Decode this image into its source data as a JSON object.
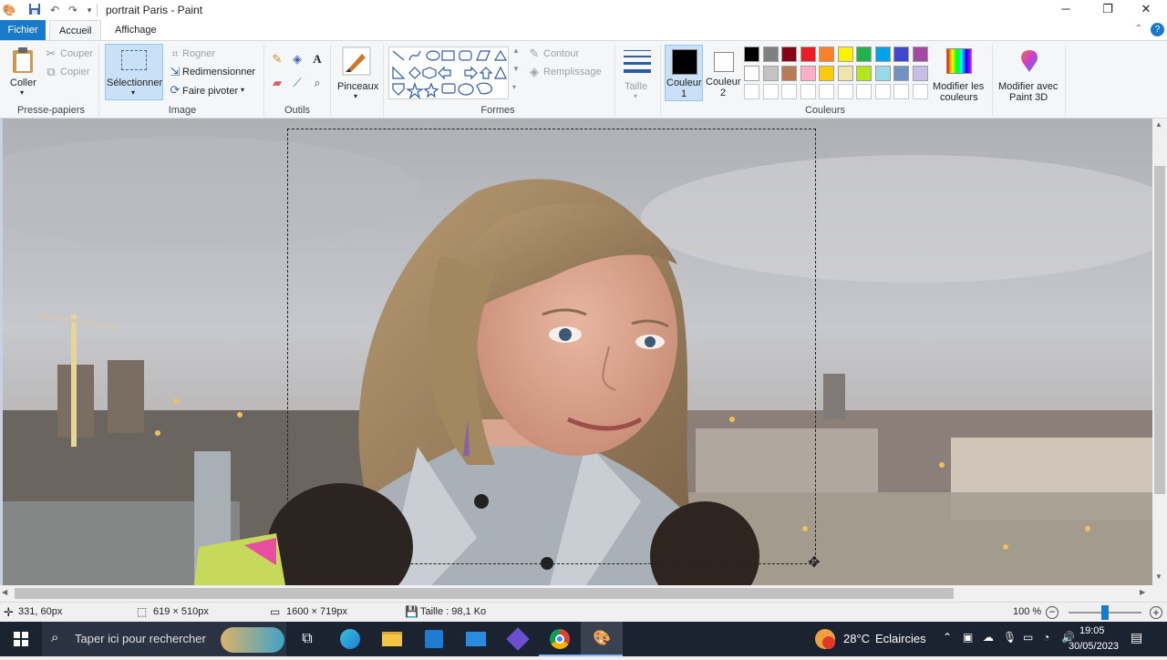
{
  "window": {
    "title": "portrait Paris - Paint",
    "quick_access": [
      "save-icon",
      "undo-icon",
      "redo-icon",
      "customize-icon"
    ]
  },
  "tabs": {
    "file": "Fichier",
    "home": "Accueil",
    "view": "Affichage"
  },
  "ribbon": {
    "clipboard": {
      "paste": "Coller",
      "cut": "Couper",
      "copy": "Copier",
      "label": "Presse-papiers"
    },
    "image": {
      "select": "Sélectionner",
      "crop": "Rogner",
      "resize": "Redimensionner",
      "rotate": "Faire pivoter",
      "label": "Image"
    },
    "tools": {
      "label": "Outils"
    },
    "brushes": {
      "label": "Pinceaux"
    },
    "shapes": {
      "outline": "Contour",
      "fill": "Remplissage",
      "label": "Formes"
    },
    "size": {
      "label": "Taille"
    },
    "colors": {
      "color1_line1": "Couleur",
      "color1_line2": "1",
      "color2_line1": "Couleur",
      "color2_line2": "2",
      "edit_line1": "Modifier les",
      "edit_line2": "couleurs",
      "paint3d_line1": "Modifier avec",
      "paint3d_line2": "Paint 3D",
      "label": "Couleurs",
      "color1": "#000000",
      "color2": "#ffffff",
      "palette_row1": [
        "#000000",
        "#7f7f7f",
        "#880015",
        "#ed1c24",
        "#ff7f27",
        "#fff200",
        "#22b14c",
        "#00a2e8",
        "#3f48cc",
        "#a349a4"
      ],
      "palette_row2": [
        "#ffffff",
        "#c3c3c3",
        "#b97a57",
        "#ffaec9",
        "#ffc90e",
        "#efe4b0",
        "#b5e61d",
        "#99d9ea",
        "#7092be",
        "#c8bfe7"
      ],
      "palette_row3": [
        "#ffffff",
        "#ffffff",
        "#ffffff",
        "#ffffff",
        "#ffffff",
        "#ffffff",
        "#ffffff",
        "#ffffff",
        "#ffffff",
        "#ffffff"
      ]
    }
  },
  "status": {
    "cursor_pos": "331, 60px",
    "selection_size": "619 × 510px",
    "image_size": "1600 × 719px",
    "file_size": "Taille : 98,1 Ko",
    "zoom": "100 %",
    "zoom_level": 0.5
  },
  "taskbar": {
    "search_placeholder": "Taper ici pour rechercher",
    "weather_temp": "28°C",
    "weather_desc": "Eclaircies",
    "time": "19:05",
    "date": "30/05/2023"
  }
}
